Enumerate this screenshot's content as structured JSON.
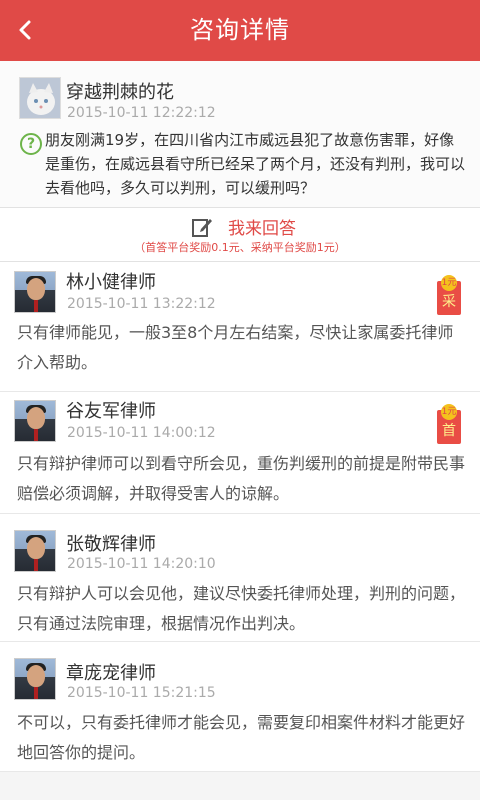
{
  "header": {
    "title": "咨询详情",
    "back_icon": "back-arrow-icon"
  },
  "question": {
    "username": "穿越荆棘的花",
    "time": "2015-10-11 12:22:12",
    "icon": "question-mark-icon",
    "text": "朋友刚满19岁，在四川省内江市威远县犯了故意伤害罪，好像是重伤，在威远县看守所已经呆了两个月，还没有判刑，我可以去看他吗，多久可以判刑，可以缓刑吗？"
  },
  "answer_action": {
    "label": "我来回答",
    "icon": "edit-icon",
    "reward_text": "（首答平台奖励0.1元、采纳平台奖励1元）"
  },
  "answers": [
    {
      "name": "林小健律师",
      "time": "2015-10-11 13:22:12",
      "text": "只有律师能见，一般3至8个月左右结案，尽快让家属委托律师介入帮助。",
      "badge": "采",
      "badge_coin": "1元"
    },
    {
      "name": "谷友军律师",
      "time": "2015-10-11 14:00:12",
      "text": "只有辩护律师可以到看守所会见，重伤判缓刑的前提是附带民事赔偿必须调解，并取得受害人的谅解。",
      "badge": "首",
      "badge_coin": "1元"
    },
    {
      "name": "张敬辉律师",
      "time": "2015-10-11 14:20:10",
      "text": "只有辩护人可以会见他，建议尽快委托律师处理，判刑的问题，只有通过法院审理，根据情况作出判决。"
    },
    {
      "name": "章庞宠律师",
      "time": "2015-10-11 15:21:15",
      "text": "不可以，只有委托律师才能会见，需要复印相案件材料才能更好地回答你的提问。"
    }
  ],
  "colors": {
    "accent": "#e04a47",
    "question_icon": "#6db44a",
    "time": "#aaaaaa"
  }
}
